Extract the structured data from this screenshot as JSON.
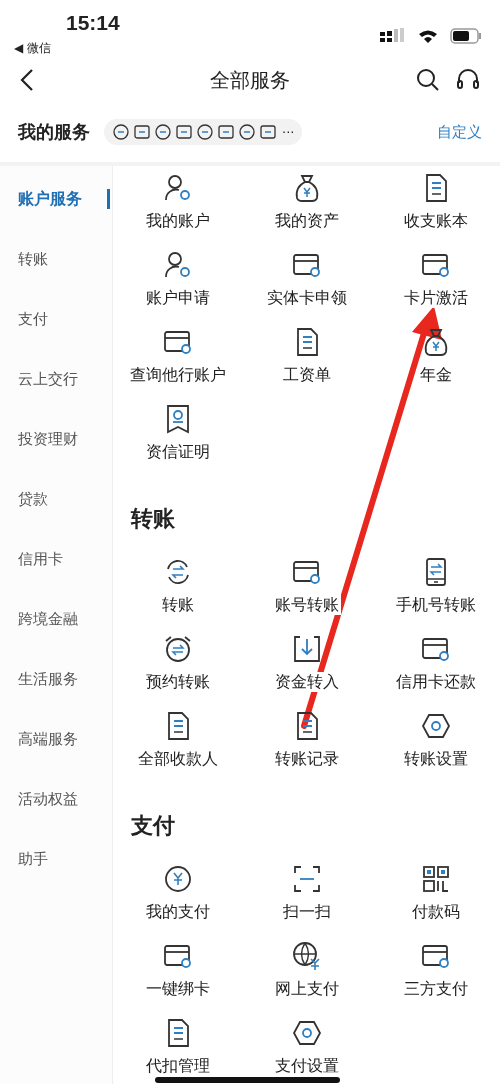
{
  "status_bar": {
    "time": "15:14",
    "back_app": "◀ 微信"
  },
  "nav": {
    "title": "全部服务"
  },
  "my_services": {
    "title": "我的服务",
    "more": "···",
    "customize": "自定义"
  },
  "sidebar": {
    "items": [
      {
        "label": "账户服务",
        "selected": true
      },
      {
        "label": "转账",
        "selected": false
      },
      {
        "label": "支付",
        "selected": false
      },
      {
        "label": "云上交行",
        "selected": false
      },
      {
        "label": "投资理财",
        "selected": false
      },
      {
        "label": "贷款",
        "selected": false
      },
      {
        "label": "信用卡",
        "selected": false
      },
      {
        "label": "跨境金融",
        "selected": false
      },
      {
        "label": "生活服务",
        "selected": false
      },
      {
        "label": "高端服务",
        "selected": false
      },
      {
        "label": "活动权益",
        "selected": false
      },
      {
        "label": "助手",
        "selected": false
      }
    ]
  },
  "sections": [
    {
      "items": [
        "我的账户",
        "我的资产",
        "收支账本",
        "账户申请",
        "实体卡申领",
        "卡片激活",
        "查询他行账户",
        "工资单",
        "年金",
        "资信证明"
      ]
    },
    {
      "title": "转账",
      "items": [
        "转账",
        "账号转账",
        "手机号转账",
        "预约转账",
        "资金转入",
        "信用卡还款",
        "全部收款人",
        "转账记录",
        "转账设置"
      ]
    },
    {
      "title": "支付",
      "items": [
        "我的支付",
        "扫一扫",
        "付款码",
        "一键绑卡",
        "网上支付",
        "三方支付",
        "代扣管理",
        "支付设置"
      ]
    }
  ]
}
